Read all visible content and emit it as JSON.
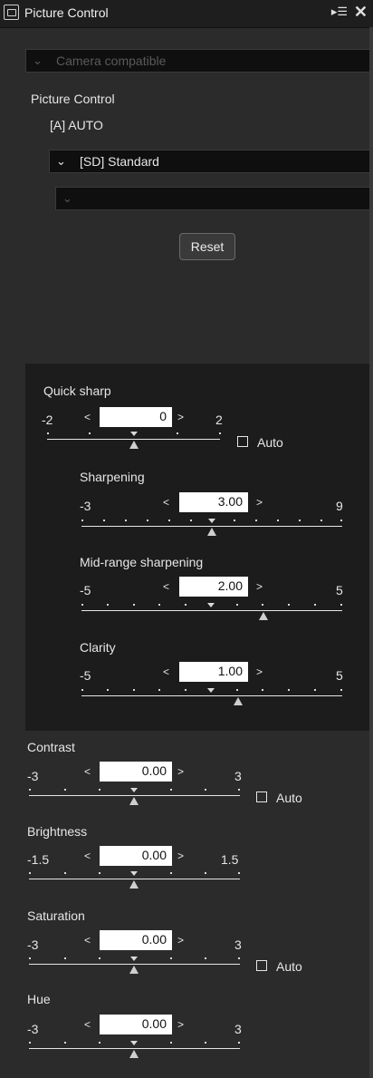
{
  "titlebar": {
    "title": "Picture Control",
    "menu_icon": "panel-menu-icon",
    "close_icon": "close-icon"
  },
  "camera_dropdown": {
    "label": "Camera compatible"
  },
  "picture_control": {
    "heading": "Picture Control",
    "auto_label": "[A] AUTO",
    "selected": "[SD] Standard",
    "sub_value": "",
    "reset_label": "Reset"
  },
  "quick_sharp": {
    "label": "Quick sharp",
    "min": "-2",
    "max": "2",
    "value": "0",
    "auto_label": "Auto"
  },
  "sharpening": {
    "label": "Sharpening",
    "min": "-3",
    "max": "9",
    "value": "3.00"
  },
  "midrange": {
    "label": "Mid-range sharpening",
    "min": "-5",
    "max": "5",
    "value": "2.00"
  },
  "clarity": {
    "label": "Clarity",
    "min": "-5",
    "max": "5",
    "value": "1.00"
  },
  "contrast": {
    "label": "Contrast",
    "min": "-3",
    "max": "3",
    "value": "0.00",
    "auto_label": "Auto"
  },
  "brightness": {
    "label": "Brightness",
    "min": "-1.5",
    "max": "1.5",
    "value": "0.00"
  },
  "saturation": {
    "label": "Saturation",
    "min": "-3",
    "max": "3",
    "value": "0.00",
    "auto_label": "Auto"
  },
  "hue": {
    "label": "Hue",
    "min": "-3",
    "max": "3",
    "value": "0.00"
  },
  "glyphs": {
    "chev": "⌄",
    "left": "<",
    "right": ">",
    "menu": "▸☰",
    "close": "✕"
  }
}
